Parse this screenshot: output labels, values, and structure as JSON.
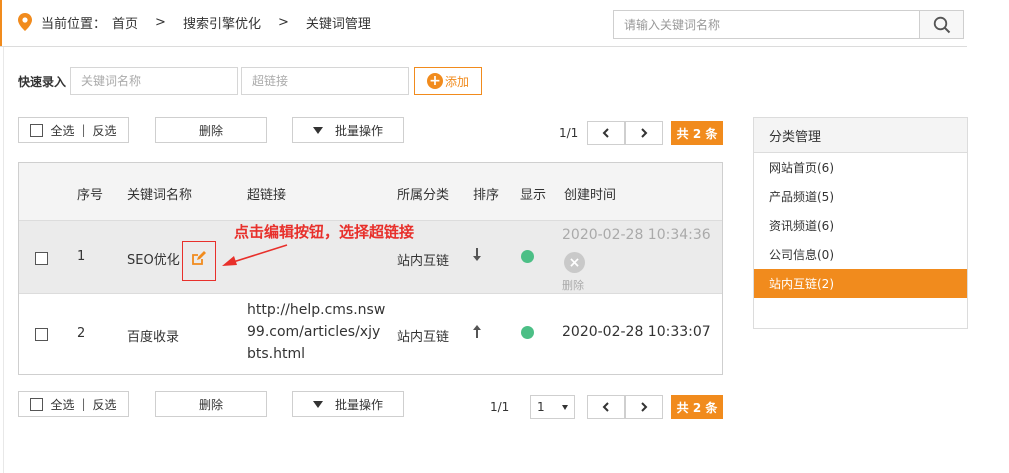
{
  "breadcrumb": {
    "label": "当前位置：",
    "items": [
      "首页",
      "搜索引擎优化",
      "关键词管理"
    ],
    "separator": ">"
  },
  "search": {
    "placeholder": "请输入关键词名称"
  },
  "quick_entry": {
    "label": "快速录入",
    "keyword_placeholder": "关键词名称",
    "link_placeholder": "超链接",
    "add_label": "添加"
  },
  "toolbar": {
    "select_all": "全选",
    "divider": "|",
    "invert": "反选",
    "delete": "删除",
    "batch": "批量操作",
    "page_info": "1/1",
    "total": "共 2 条",
    "page_select": "1"
  },
  "table": {
    "headers": [
      "序号",
      "关键词名称",
      "超链接",
      "所属分类",
      "排序",
      "显示",
      "创建时间"
    ],
    "rows": [
      {
        "seq": "1",
        "name": "SEO优化",
        "link_lines": [],
        "category": "站内互链",
        "sort": "down",
        "show": true,
        "time": "2020-02-28 10:34:36",
        "delete_label": "删除"
      },
      {
        "seq": "2",
        "name": "百度收录",
        "link_lines": [
          "http://help.cms.nsw",
          "99.com/articles/xjy",
          "bts.html"
        ],
        "category": "站内互链",
        "sort": "up",
        "show": true,
        "time": "2020-02-28 10:33:07"
      }
    ]
  },
  "annotation": {
    "text": "点击编辑按钮，选择超链接"
  },
  "sidebar": {
    "title": "分类管理",
    "items": [
      {
        "label": "网站首页(6)",
        "active": false
      },
      {
        "label": "产品频道(5)",
        "active": false
      },
      {
        "label": "资讯频道(6)",
        "active": false
      },
      {
        "label": "公司信息(0)",
        "active": false
      },
      {
        "label": "站内互链(2)",
        "active": true
      }
    ]
  },
  "colors": {
    "accent": "#f18b1d",
    "show_dot": "#4cbf86",
    "annotation": "#e8302b"
  },
  "icons": [
    "location-pin-icon",
    "search-icon",
    "plus-circle-icon",
    "chevron-left-icon",
    "chevron-right-icon",
    "edit-icon",
    "close-circle-icon",
    "arrow-down-icon",
    "arrow-up-icon"
  ]
}
